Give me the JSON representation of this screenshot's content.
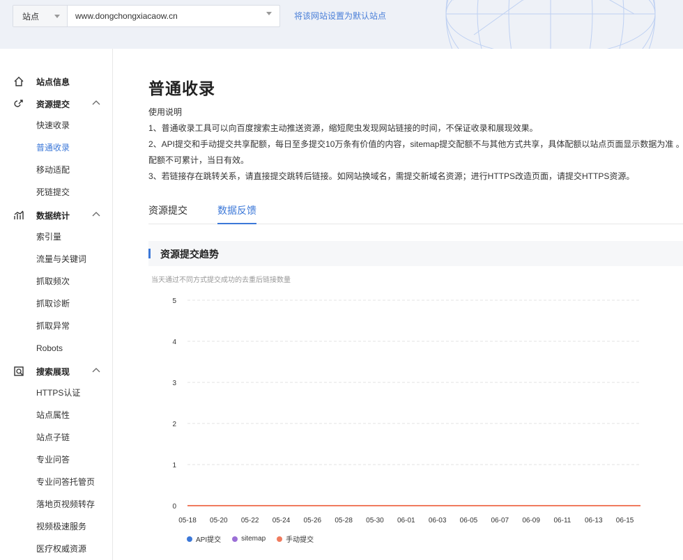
{
  "topbar": {
    "site_type": "站点",
    "site_url": "www.dongchongxiacaow.cn",
    "set_default_link": "将该网站设置为默认站点"
  },
  "sidebar": {
    "groups": [
      {
        "label": "站点信息",
        "icon": "home-icon"
      },
      {
        "label": "资源提交",
        "icon": "link-icon",
        "items": [
          "快速收录",
          "普通收录",
          "移动适配",
          "死链提交"
        ]
      },
      {
        "label": "数据统计",
        "icon": "stats-icon",
        "items": [
          "索引量",
          "流量与关键词",
          "抓取频次",
          "抓取诊断",
          "抓取异常",
          "Robots"
        ]
      },
      {
        "label": "搜索展现",
        "icon": "search-display-icon",
        "items": [
          "HTTPS认证",
          "站点属性",
          "站点子链",
          "专业问答",
          "专业问答托管页",
          "落地页视频转存",
          "视频极速服务",
          "医疗权威资源"
        ]
      }
    ],
    "active_item": "普通收录"
  },
  "page": {
    "title": "普通收录",
    "notes": [
      "使用说明",
      "1、普通收录工具可以向百度搜索主动推送资源，缩短爬虫发现网站链接的时间，不保证收录和展现效果。",
      "2、API提交和手动提交共享配额，每日至多提交10万条有价值的内容，sitemap提交配额不与其他方式共享，具体配额以站点页面显示数据为准 。配额不可累计，当日有效。",
      "3、若链接存在跳转关系，请直接提交跳转后链接。如网站换域名，需提交新域名资源；进行HTTPS改造页面，请提交HTTPS资源。"
    ],
    "tabs": [
      "资源提交",
      "数据反馈"
    ],
    "active_tab": "数据反馈",
    "section_title": "资源提交趋势",
    "chart_subtitle": "当天通过不同方式提交成功的去重后链接数量"
  },
  "chart_data": {
    "type": "line",
    "title": "资源提交趋势",
    "subtitle": "当天通过不同方式提交成功的去重后链接数量",
    "x": [
      "05-18",
      "05-19",
      "05-20",
      "05-21",
      "05-22",
      "05-23",
      "05-24",
      "05-25",
      "05-26",
      "05-27",
      "05-28",
      "05-29",
      "05-30",
      "05-31",
      "06-01",
      "06-02",
      "06-03",
      "06-04",
      "06-05",
      "06-06",
      "06-07",
      "06-08",
      "06-09",
      "06-10",
      "06-11",
      "06-12",
      "06-13",
      "06-14",
      "06-15",
      "06-16"
    ],
    "xticks": [
      "05-18",
      "05-20",
      "05-22",
      "05-24",
      "05-26",
      "05-28",
      "05-30",
      "06-01",
      "06-03",
      "06-05",
      "06-07",
      "06-09",
      "06-11",
      "06-13",
      "06-15"
    ],
    "yticks": [
      0,
      1,
      2,
      3,
      4,
      5
    ],
    "ylim": [
      0,
      5
    ],
    "grid": true,
    "legend_position": "bottom-left",
    "series": [
      {
        "name": "API提交",
        "color": "#3c78d8",
        "values": [
          0,
          0,
          0,
          0,
          0,
          0,
          0,
          0,
          0,
          0,
          0,
          0,
          0,
          0,
          0,
          0,
          0,
          0,
          0,
          0,
          0,
          0,
          0,
          0,
          0,
          0,
          0,
          0,
          0,
          0
        ]
      },
      {
        "name": "sitemap",
        "color": "#9b6fd6",
        "values": [
          0,
          0,
          0,
          0,
          0,
          0,
          0,
          0,
          0,
          0,
          0,
          0,
          0,
          0,
          0,
          0,
          0,
          0,
          0,
          0,
          0,
          0,
          0,
          0,
          0,
          0,
          0,
          0,
          0,
          0
        ]
      },
      {
        "name": "手动提交",
        "color": "#f07b5e",
        "values": [
          0,
          0,
          0,
          0,
          0,
          0,
          0,
          0,
          0,
          0,
          0,
          0,
          0,
          0,
          0,
          0,
          0,
          0,
          0,
          0,
          0,
          0,
          0,
          0,
          0,
          0,
          0,
          0,
          0,
          0
        ]
      }
    ]
  }
}
